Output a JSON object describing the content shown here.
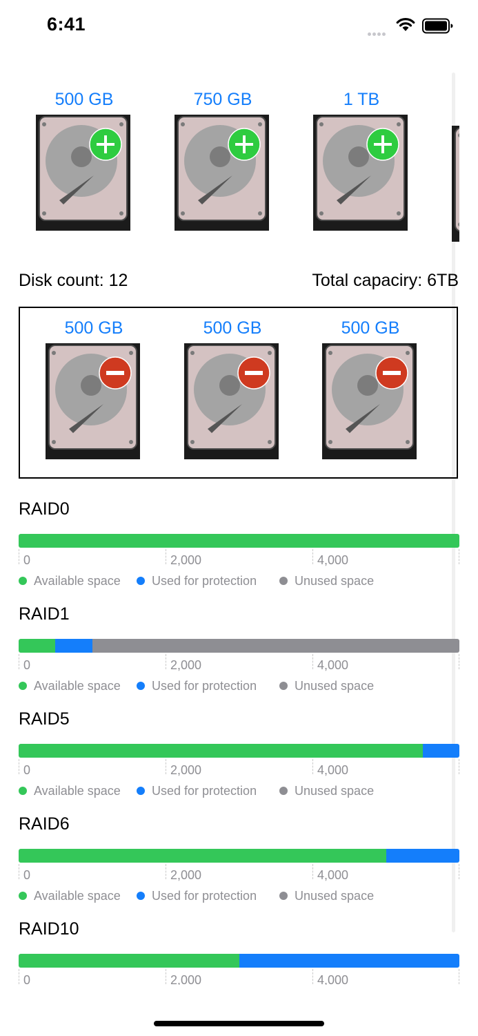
{
  "status_bar": {
    "time": "6:41"
  },
  "colors": {
    "accent": "#147efb",
    "available": "#34c759",
    "protection": "#147efb",
    "unused": "#8e8e93",
    "add_badge": "#2ecc40",
    "remove_badge": "#cf3a20"
  },
  "available_disks": [
    {
      "label": "500 GB",
      "icon": "hard-drive-add-icon"
    },
    {
      "label": "750 GB",
      "icon": "hard-drive-add-icon"
    },
    {
      "label": "1 TB",
      "icon": "hard-drive-add-icon"
    }
  ],
  "summary": {
    "disk_count": "Disk count: 12",
    "total_capacity": "Total capaciry: 6TB"
  },
  "selected_disks": [
    {
      "label": "500 GB",
      "icon": "hard-drive-remove-icon"
    },
    {
      "label": "500 GB",
      "icon": "hard-drive-remove-icon"
    },
    {
      "label": "500 GB",
      "icon": "hard-drive-remove-icon"
    }
  ],
  "legend": {
    "available": "Available space",
    "protection": "Used for protection",
    "unused": "Unused space"
  },
  "axis_ticks": [
    "0",
    "2,000",
    "4,000"
  ],
  "raids": [
    {
      "name": "RAID0",
      "available": 6000,
      "protection": 0,
      "unused": 0
    },
    {
      "name": "RAID1",
      "available": 500,
      "protection": 500,
      "unused": 5000
    },
    {
      "name": "RAID5",
      "available": 5500,
      "protection": 500,
      "unused": 0
    },
    {
      "name": "RAID6",
      "available": 5000,
      "protection": 1000,
      "unused": 0
    },
    {
      "name": "RAID10",
      "available": 3000,
      "protection": 3000,
      "unused": 0
    }
  ]
}
